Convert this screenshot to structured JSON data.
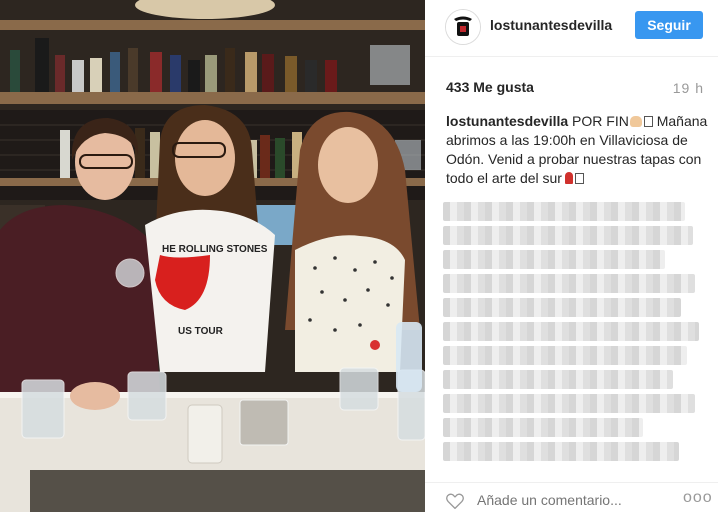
{
  "post": {
    "username": "lostunantesdevilla",
    "follow_label": "Seguir",
    "likes": "433 Me gusta",
    "time": "19 h",
    "caption_user": "lostunantesdevilla",
    "caption_text_1": "POR FIN",
    "caption_text_2": "Mañana abrimos a las 19:00h en Villaviciosa de Odón. Venid a probar nuestras tapas con todo el arte del sur"
  },
  "footer": {
    "comment_placeholder": "Añade un comentario...",
    "more_label": "ooo"
  },
  "photo": {
    "shirt_text_1": "HE ROLLING STONES",
    "shirt_text_2": "US TOUR"
  },
  "colors": {
    "follow_bg": "#3897f0",
    "text": "#262626",
    "muted": "#999999"
  }
}
